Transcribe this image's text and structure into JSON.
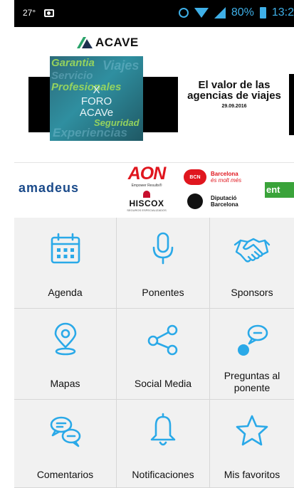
{
  "status_bar": {
    "temperature": "27°",
    "battery_percent": "80%",
    "time": "13:2",
    "icons": [
      "photo-icon",
      "alarm-icon",
      "wifi-icon",
      "signal-icon",
      "battery-icon"
    ]
  },
  "banner": {
    "logo_text": "ACAVE",
    "foro_card": {
      "words": [
        "Garantia",
        "Viajes",
        "Servicio",
        "Profesionales",
        "Seguridad",
        "Experiencias"
      ],
      "title_line1": "X",
      "title_line2": "FORO",
      "title_line3": "ACAVe"
    },
    "headline_line1": "El valor de las",
    "headline_line2": "agencias de viajes",
    "date": "29.09.2016"
  },
  "sponsors": {
    "amadeus": "amadeus",
    "aon": "AON",
    "aon_tagline": "Empower Results®",
    "hiscox": "HISCOX",
    "hiscox_sub": "SEGUROS ESPECIALIZADOS",
    "bcn_badge": "BCN",
    "bcn_line1": "Barcelona",
    "bcn_line2": "és molt més",
    "diputacio_line1": "Diputació",
    "diputacio_line2": "Barcelona",
    "cut_logo": "ent"
  },
  "menu": [
    {
      "label": "Agenda",
      "icon": "calendar-icon"
    },
    {
      "label": "Ponentes",
      "icon": "microphone-icon"
    },
    {
      "label": "Sponsors",
      "icon": "handshake-icon"
    },
    {
      "label": "Mapas",
      "icon": "map-pin-icon"
    },
    {
      "label": "Social Media",
      "icon": "share-icon"
    },
    {
      "label_line1": "Preguntas al",
      "label_line2": "ponente",
      "icon": "question-bubble-icon"
    },
    {
      "label": "Comentarios",
      "icon": "chat-bubbles-icon"
    },
    {
      "label": "Notificaciones",
      "icon": "bell-icon"
    },
    {
      "label": "Mis favoritos",
      "icon": "star-icon"
    }
  ],
  "colors": {
    "accent": "#2aa9e8",
    "grid_bg": "#f1f1f1"
  }
}
